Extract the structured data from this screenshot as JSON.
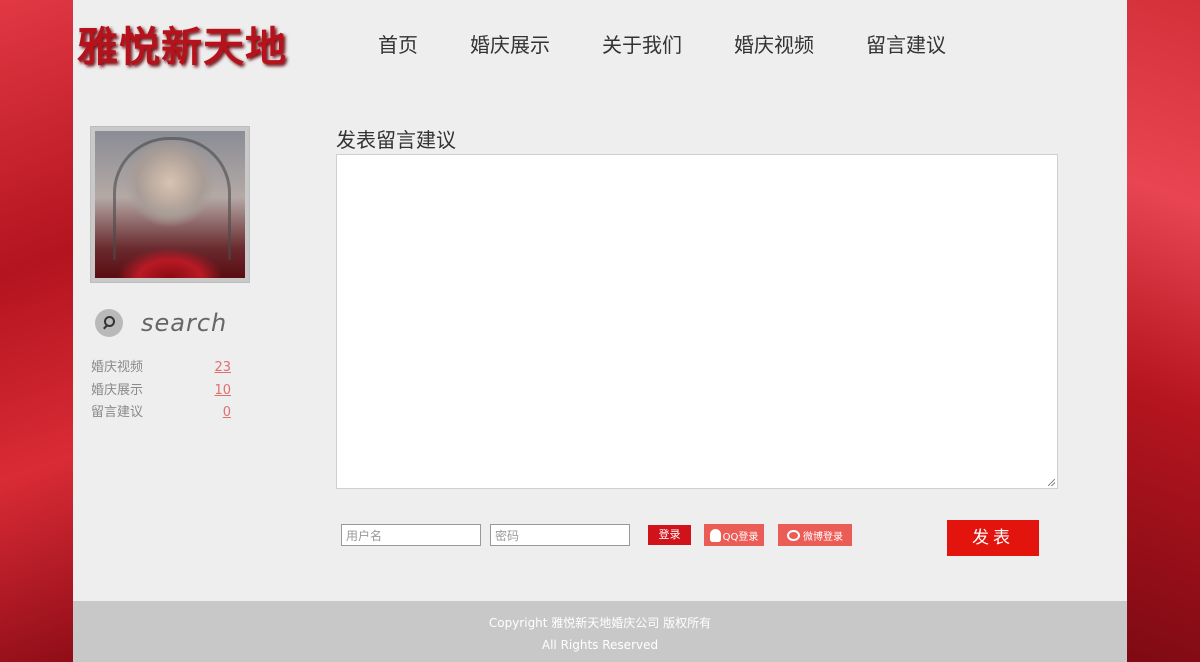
{
  "brand": {
    "logo": "雅悦新天地"
  },
  "nav": {
    "items": [
      "首页",
      "婚庆展示",
      "关于我们",
      "婚庆视频",
      "留言建议"
    ]
  },
  "sidebar": {
    "search_label": "search",
    "categories": [
      {
        "name": "婚庆视频",
        "count": "23"
      },
      {
        "name": "婚庆展示",
        "count": "10"
      },
      {
        "name": "留言建议",
        "count": "0"
      }
    ]
  },
  "main": {
    "title": "发表留言建议",
    "message_placeholder": "",
    "username_placeholder": "用户名",
    "password_placeholder": "密码",
    "login_label": "登录",
    "qq_login_label": "QQ登录",
    "weibo_login_label": "微博登录",
    "post_label": "发表"
  },
  "footer": {
    "line1": "Copyright 雅悦新天地婚庆公司 版权所有",
    "line2": "All Rights Reserved"
  },
  "colors": {
    "accent": "#e3140e",
    "brand_red": "#b5121b",
    "background": "#eeeeee",
    "footer_bg": "#c8c8c8"
  }
}
